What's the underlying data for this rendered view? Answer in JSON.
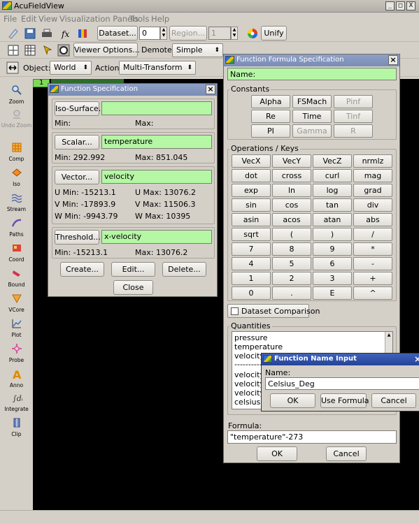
{
  "window": {
    "title": "AcuFieldView",
    "controls": [
      "_",
      "□",
      "X"
    ]
  },
  "menu": [
    "File",
    "Edit",
    "View",
    "Visualization Panels",
    "Tools",
    "Help"
  ],
  "toolbar1": {
    "dataset_label": "Dataset...",
    "dataset_value": "0",
    "region_label": "Region...",
    "region_value": "1",
    "unify_label": "Unify"
  },
  "toolbar2": {
    "viewer_options_label": "Viewer Options...",
    "demote_label": "Demote:",
    "demote_value": "Simple"
  },
  "toolbar3": {
    "object_label": "Object:",
    "object_value": "World",
    "action_label": "Action:",
    "action_value": "Multi-Transform"
  },
  "viewport_tab": "1",
  "palette": [
    {
      "icon": "zoom-icon",
      "label": "Zoom"
    },
    {
      "icon": "undo-zoom-icon",
      "label": "Undo Zoom"
    },
    {
      "icon": "comp-icon",
      "label": "Comp"
    },
    {
      "icon": "iso-icon",
      "label": "Iso"
    },
    {
      "icon": "stream-icon",
      "label": "Stream"
    },
    {
      "icon": "paths-icon",
      "label": "Paths"
    },
    {
      "icon": "coord-icon",
      "label": "Coord"
    },
    {
      "icon": "bound-icon",
      "label": "Bound"
    },
    {
      "icon": "vcore-icon",
      "label": "VCore"
    },
    {
      "icon": "plot-icon",
      "label": "Plot"
    },
    {
      "icon": "probe-icon",
      "label": "Probe"
    },
    {
      "icon": "anno-icon",
      "label": "Anno"
    },
    {
      "icon": "integrate-icon",
      "label": "Integrate"
    },
    {
      "icon": "clip-icon",
      "label": "Clip"
    }
  ],
  "func_spec": {
    "title": "Function Specification",
    "iso_label": "Iso-Surface...",
    "iso_value": "",
    "iso_min_label": "Min:",
    "iso_max_label": "Max:",
    "scalar_label": "Scalar...",
    "scalar_value": "temperature",
    "scalar_min": "Min:  292.992",
    "scalar_max": "Max:  851.045",
    "vector_label": "Vector...",
    "vector_value": "velocity",
    "u_min": "U Min:   -15213.1",
    "u_max": "U Max:   13076.2",
    "v_min": "V Min:   -17893.9",
    "v_max": "V Max:   11506.3",
    "w_min": "W Min:   -9943.79",
    "w_max": "W Max:   10395",
    "threshold_label": "Threshold...",
    "threshold_value": "x-velocity",
    "t_min": "Min:  -15213.1",
    "t_max": "Max:  13076.2",
    "create_label": "Create...",
    "edit_label": "Edit...",
    "delete_label": "Delete...",
    "close_label": "Close"
  },
  "formula_dialog": {
    "title": "Function Formula Specification",
    "name_label": "Name:",
    "constants_title": "Constants",
    "constants": [
      "Alpha",
      "FSMach",
      "Pinf",
      "Re",
      "Time",
      "Tinf",
      "PI",
      "Gamma",
      "R"
    ],
    "ops_title": "Operations / Keys",
    "keys": [
      "VecX",
      "VecY",
      "VecZ",
      "nrmlz",
      "dot",
      "cross",
      "curl",
      "mag",
      "exp",
      "ln",
      "log",
      "grad",
      "sin",
      "cos",
      "tan",
      "div",
      "asin",
      "acos",
      "atan",
      "abs",
      "sqrt",
      "(",
      ")",
      "/",
      "7",
      "8",
      "9",
      "*",
      "4",
      "5",
      "6",
      "-",
      "1",
      "2",
      "3",
      "+",
      "0",
      ".",
      "E",
      "^"
    ],
    "dataset_comparison": "Dataset Comparison",
    "quantities_title": "Quantities",
    "quantities": [
      "pressure",
      "temperature",
      "velocity",
      "------------",
      "velocity |",
      "velocity |",
      "velocity |",
      "celsius"
    ],
    "formula_label": "Formula:",
    "formula_value": "\"temperature\"-273",
    "ok_label": "OK",
    "cancel_label": "Cancel"
  },
  "name_input": {
    "title": "Function Name Input",
    "name_label": "Name:",
    "name_value": "Celsius_Deg",
    "ok_label": "OK",
    "use_formula_label": "Use Formula",
    "cancel_label": "Cancel"
  },
  "colors": {
    "field_green": "#b5f7a4",
    "title_active": "#24449a",
    "viewport": "#000000",
    "chrome": "#d4d0c8"
  }
}
